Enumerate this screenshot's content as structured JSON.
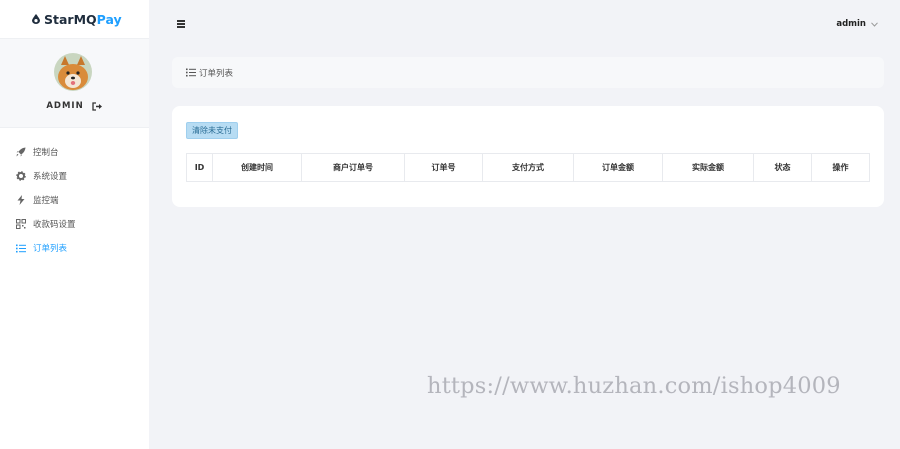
{
  "brand": {
    "part1": "StarMQ",
    "part2": "Pay"
  },
  "profile": {
    "username": "ADMIN"
  },
  "menu": [
    {
      "label": "控制台",
      "icon": "rocket-icon"
    },
    {
      "label": "系统设置",
      "icon": "gear-icon"
    },
    {
      "label": "监控端",
      "icon": "bolt-icon"
    },
    {
      "label": "收款码设置",
      "icon": "qrcode-icon"
    },
    {
      "label": "订单列表",
      "icon": "list-icon",
      "active": true
    }
  ],
  "topbar": {
    "user": "admin"
  },
  "breadcrumb": {
    "label": "订单列表"
  },
  "toolbar": {
    "clean_label": "清除未支付"
  },
  "table": {
    "columns": [
      "ID",
      "创建时间",
      "商户订单号",
      "订单号",
      "支付方式",
      "订单金额",
      "实际金额",
      "状态",
      "操作"
    ]
  },
  "watermark": "https://www.huzhan.com/ishop4009",
  "colors": {
    "accent": "#1e9fff",
    "button_bg": "#b7dcf3"
  }
}
